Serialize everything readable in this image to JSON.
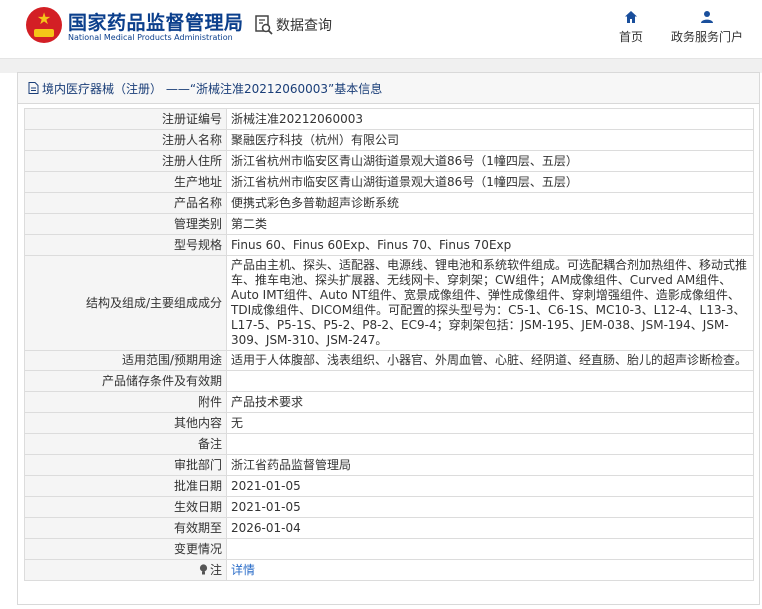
{
  "header": {
    "brand_cn": "国家药品监督管理局",
    "brand_en": "National Medical Products Administration",
    "query_label": "数据查询",
    "nav_home": "首页",
    "nav_portal": "政务服务门户"
  },
  "panel": {
    "title": "境内医疗器械（注册） ——“浙械注准20212060003”基本信息"
  },
  "rows": [
    {
      "label": "注册证编号",
      "value": "浙械注准20212060003"
    },
    {
      "label": "注册人名称",
      "value": "聚融医疗科技（杭州）有限公司"
    },
    {
      "label": "注册人住所",
      "value": "浙江省杭州市临安区青山湖街道景观大道86号（1幢四层、五层）"
    },
    {
      "label": "生产地址",
      "value": "浙江省杭州市临安区青山湖街道景观大道86号（1幢四层、五层）"
    },
    {
      "label": "产品名称",
      "value": "便携式彩色多普勒超声诊断系统"
    },
    {
      "label": "管理类别",
      "value": "第二类"
    },
    {
      "label": "型号规格",
      "value": "Finus 60、Finus 60Exp、Finus 70、Finus 70Exp"
    },
    {
      "label": "结构及组成/主要组成成分",
      "value": "产品由主机、探头、适配器、电源线、锂电池和系统软件组成。可选配耦合剂加热组件、移动式推车、推车电池、探头扩展器、无线网卡、穿刺架；CW组件；AM成像组件、Curved AM组件、Auto IMT组件、Auto NT组件、宽景成像组件、弹性成像组件、穿刺增强组件、造影成像组件、TDI成像组件、DICOM组件。可配置的探头型号为：C5-1、C6-1S、MC10-3、L12-4、L13-3、L17-5、P5-1S、P5-2、P8-2、EC9-4；穿刺架包括：JSM-195、JEM-038、JSM-194、JSM-309、JSM-310、JSM-247。"
    },
    {
      "label": "适用范围/预期用途",
      "value": "适用于人体腹部、浅表组织、小器官、外周血管、心脏、经阴道、经直肠、胎儿的超声诊断检查。"
    },
    {
      "label": "产品储存条件及有效期",
      "value": ""
    },
    {
      "label": "附件",
      "value": "产品技术要求"
    },
    {
      "label": "其他内容",
      "value": "无"
    },
    {
      "label": "备注",
      "value": ""
    },
    {
      "label": "审批部门",
      "value": "浙江省药品监督管理局"
    },
    {
      "label": "批准日期",
      "value": "2021-01-05"
    },
    {
      "label": "生效日期",
      "value": "2021-01-05"
    },
    {
      "label": "有效期至",
      "value": "2026-01-04"
    },
    {
      "label": "变更情况",
      "value": ""
    },
    {
      "label": "注",
      "value": "详情"
    }
  ],
  "icons": {
    "logo": "national-emblem-icon",
    "query": "document-search-icon",
    "home": "home-icon",
    "portal": "user-icon",
    "title": "document-icon",
    "note": "lightbulb-icon"
  },
  "colors": {
    "brand": "#0b3f8c",
    "link": "#2a6cc8",
    "label_bg": "#f5f5f5"
  }
}
